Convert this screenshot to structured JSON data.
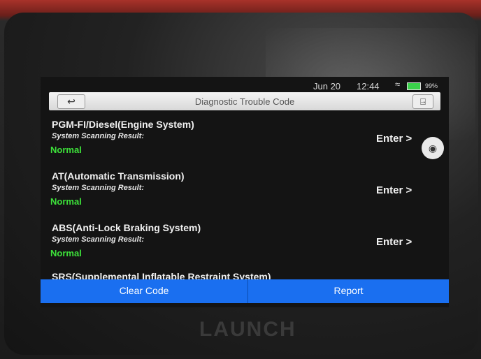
{
  "status": {
    "date": "Jun 20",
    "time": "12:44",
    "battery": "99%"
  },
  "header": {
    "title": "Diagnostic Trouble Code",
    "back_icon": "↩",
    "exit_icon": "⍈"
  },
  "systems": [
    {
      "name": "PGM-FI/Diesel(Engine System)",
      "label": "System Scanning Result:",
      "status": "Normal",
      "action": "Enter >"
    },
    {
      "name": "AT(Automatic Transmission)",
      "label": "System Scanning Result:",
      "status": "Normal",
      "action": "Enter >"
    },
    {
      "name": "ABS(Anti-Lock Braking System)",
      "label": "System Scanning Result:",
      "status": "Normal",
      "action": "Enter >"
    }
  ],
  "partial_item": "SRS(Supplemental Inflatable Restraint System)",
  "buttons": {
    "clear": "Clear Code",
    "report": "Report"
  },
  "brand": "LAUNCH",
  "colors": {
    "accent": "#1a6ff0",
    "normal": "#3de13a",
    "background": "#141414"
  }
}
